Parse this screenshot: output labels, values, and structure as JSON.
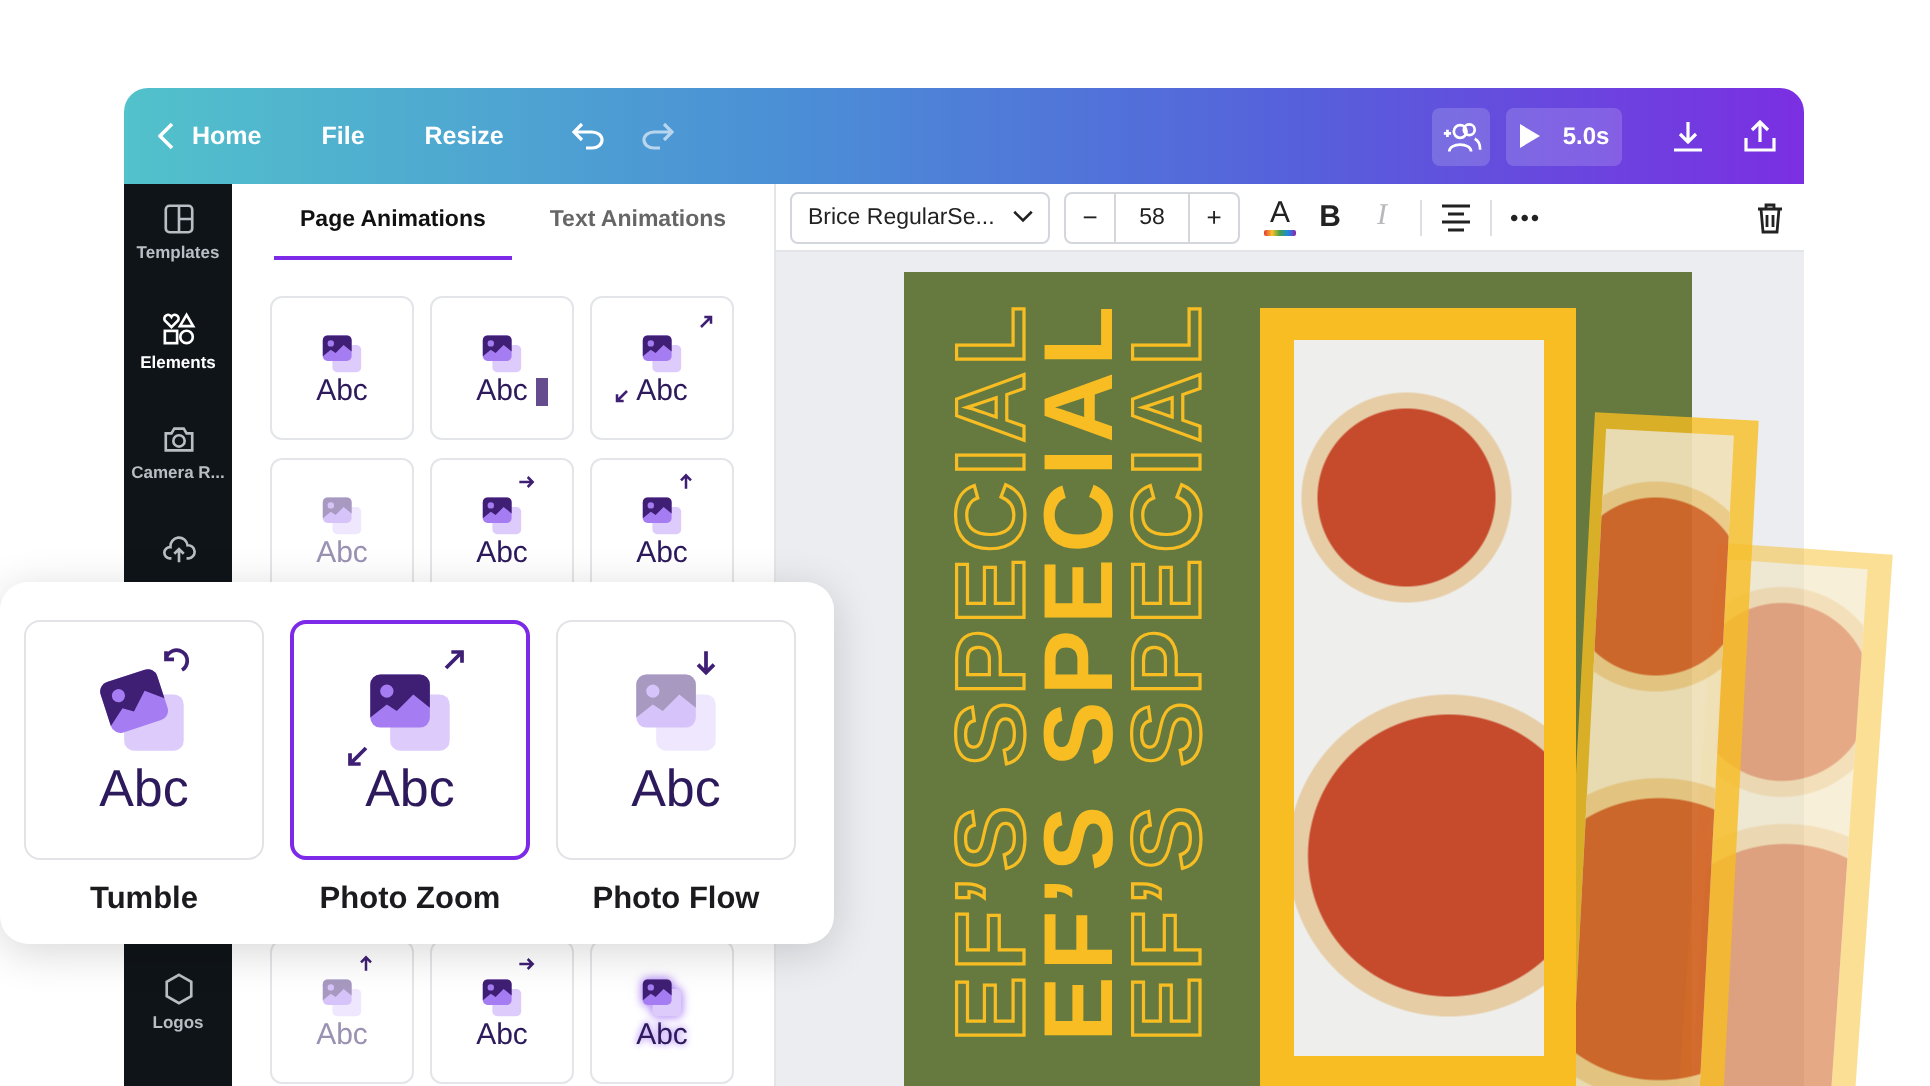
{
  "topbar": {
    "back_label": "Home",
    "menu": [
      "File",
      "Resize"
    ],
    "play": {
      "duration": "5.0s"
    }
  },
  "sidebar": {
    "items": [
      {
        "label": "Templates",
        "selected": false
      },
      {
        "label": "Elements",
        "selected": true
      },
      {
        "label": "Camera R...",
        "selected": false
      },
      {
        "selected": false
      }
    ],
    "bottom_items": [
      {
        "label": "Logos",
        "selected": false
      }
    ]
  },
  "panel": {
    "tabs": [
      {
        "label": "Page Animations",
        "selected": true
      },
      {
        "label": "Text Animations",
        "selected": false
      }
    ],
    "tiles_top": [
      {
        "preview_text": "Abc",
        "kind": "plain"
      },
      {
        "preview_text": "Abc",
        "kind": "typewriter"
      },
      {
        "preview_text": "Abc",
        "kind": "zoom"
      },
      {
        "preview_text": "Abc",
        "kind": "fade"
      },
      {
        "preview_text": "Abc",
        "kind": "slide-right"
      },
      {
        "preview_text": "Abc",
        "kind": "rise"
      }
    ],
    "tiles_bottom": [
      {
        "preview_text": "Abc",
        "kind": "rise-fade"
      },
      {
        "preview_text": "Abc",
        "kind": "pan"
      },
      {
        "preview_text": "Abc",
        "kind": "glow"
      }
    ]
  },
  "popup": {
    "items": [
      {
        "name": "Tumble",
        "preview_text": "Abc",
        "kind": "tumble",
        "selected": false
      },
      {
        "name": "Photo Zoom",
        "preview_text": "Abc",
        "kind": "zoom",
        "selected": true
      },
      {
        "name": "Photo Flow",
        "preview_text": "Abc",
        "kind": "flow",
        "selected": false
      }
    ]
  },
  "toolbar": {
    "font": "Brice RegularSe...",
    "decrease": "−",
    "size": "58",
    "increase": "+",
    "color_letter": "A",
    "format_buttons": [
      {
        "label": "B",
        "disabled": false
      },
      {
        "label": "I",
        "disabled": true
      }
    ],
    "more": "•••"
  },
  "poster": {
    "lines": [
      {
        "text": "EF’S SPECIAL",
        "kind": "outline"
      },
      {
        "text": "EF’S SPECIAL",
        "kind": "solid"
      },
      {
        "text": "EF’S SPECIAL",
        "kind": "outline"
      }
    ]
  }
}
